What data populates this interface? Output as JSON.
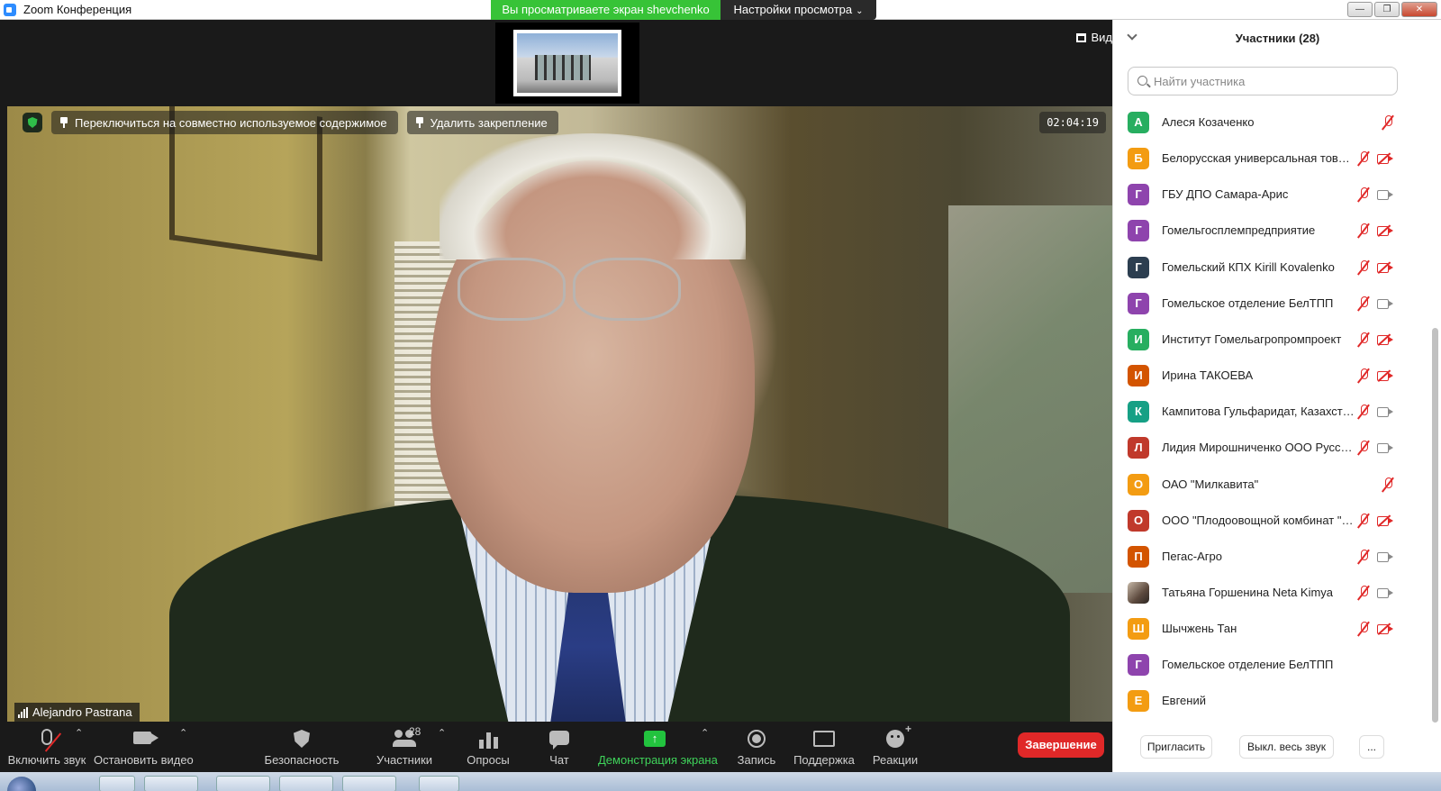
{
  "window": {
    "title": "Zoom Конференция",
    "viewing_banner": "Вы просматриваете экран shevchenko",
    "view_options": "Настройки просмотра"
  },
  "video": {
    "view_label": "Вид",
    "switch_shared": "Переключиться на совместно используемое содержимое",
    "unpin": "Удалить закрепление",
    "timer": "02:04:19",
    "speaker_name": "Alejandro Pastrana"
  },
  "toolbar": {
    "unmute": "Включить звук",
    "stop_video": "Остановить видео",
    "security": "Безопасность",
    "participants": "Участники",
    "participants_count": "28",
    "polls": "Опросы",
    "chat": "Чат",
    "share": "Демонстрация экрана",
    "record": "Запись",
    "support": "Поддержка",
    "reactions": "Реакции",
    "end": "Завершение"
  },
  "panel": {
    "title": "Участники (28)",
    "search_placeholder": "Найти участника",
    "invite": "Пригласить",
    "mute_all": "Выкл. весь звук",
    "more": "..."
  },
  "participants": [
    {
      "initial": "А",
      "name": "Алеся Козаченко",
      "color": "#27ae60",
      "mic": "off",
      "cam": "none"
    },
    {
      "initial": "Б",
      "name": "Белорусская универсальная товарная биржа",
      "color": "#f39c12",
      "mic": "off",
      "cam": "off"
    },
    {
      "initial": "Г",
      "name": "ГБУ ДПО Самара-Арис",
      "color": "#8e44ad",
      "mic": "off",
      "cam": "on"
    },
    {
      "initial": "Г",
      "name": "Гомельгосплемпредприятие",
      "color": "#8e44ad",
      "mic": "off",
      "cam": "off"
    },
    {
      "initial": "Г",
      "name": "Гомельский КПХ Kirill Kovalenko",
      "color": "#2c3e50",
      "mic": "off",
      "cam": "off"
    },
    {
      "initial": "Г",
      "name": "Гомельское отделение БелТПП",
      "color": "#8e44ad",
      "mic": "off",
      "cam": "on"
    },
    {
      "initial": "И",
      "name": "Институт Гомельагропромпроект",
      "color": "#27ae60",
      "mic": "off",
      "cam": "off"
    },
    {
      "initial": "И",
      "name": "Ирина ТАКОЕВА",
      "color": "#d35400",
      "mic": "off",
      "cam": "off"
    },
    {
      "initial": "К",
      "name": "Кампитова Гульфаридат, Казахстан",
      "color": "#16a085",
      "mic": "off",
      "cam": "on"
    },
    {
      "initial": "Л",
      "name": "Лидия Мирошниченко ООО Русский продукт",
      "color": "#c0392b",
      "mic": "off",
      "cam": "on"
    },
    {
      "initial": "О",
      "name": "ОАО \"Милкавита\"",
      "color": "#f39c12",
      "mic": "off",
      "cam": "none"
    },
    {
      "initial": "О",
      "name": "ООО \"Плодоовощной комбинат \"Агро\"",
      "color": "#c0392b",
      "mic": "off",
      "cam": "off"
    },
    {
      "initial": "П",
      "name": "Пегас-Агро",
      "color": "#d35400",
      "mic": "off",
      "cam": "on"
    },
    {
      "initial": "",
      "name": "Татьяна Горшенина Neta Kimya",
      "color": "#6b5a4c",
      "mic": "off",
      "cam": "on",
      "photo": true
    },
    {
      "initial": "Ш",
      "name": "Шычжень Тан",
      "color": "#f39c12",
      "mic": "off",
      "cam": "off"
    },
    {
      "initial": "Г",
      "name": "Гомельское отделение БелТПП",
      "color": "#8e44ad",
      "mic": "none",
      "cam": "none"
    },
    {
      "initial": "Е",
      "name": "Евгений",
      "color": "#f39c12",
      "mic": "none",
      "cam": "none"
    }
  ]
}
